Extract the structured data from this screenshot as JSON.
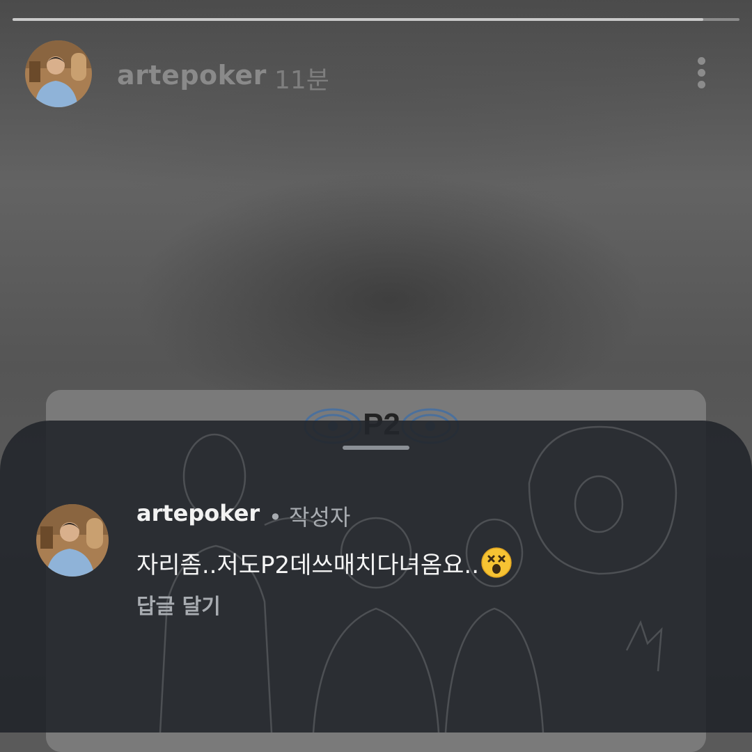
{
  "story": {
    "progress": 0.95,
    "username": "artepoker",
    "time_ago": "11분",
    "card_logo": "P2"
  },
  "comment": {
    "username": "artepoker",
    "author_tag": "• 작성자",
    "text": "자리좀..저도P2데쓰매치다녀옴요..",
    "emoji": "dizzy-face",
    "reply_label": "답글 달기"
  }
}
